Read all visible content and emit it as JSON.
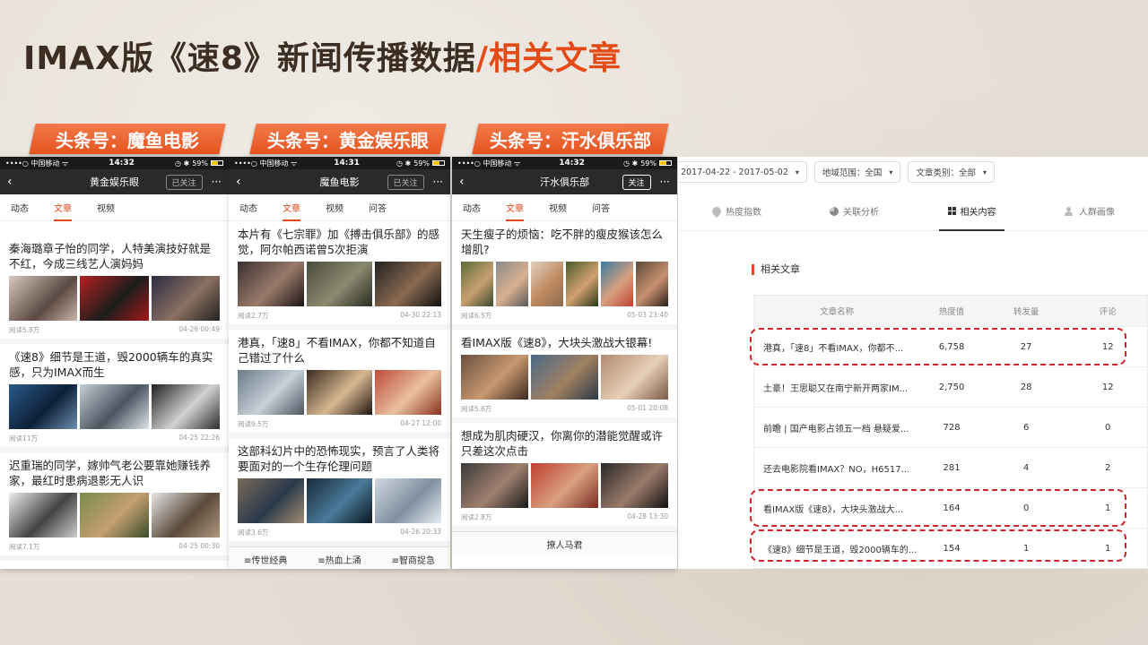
{
  "title": {
    "main": "IMAX版《速8》新闻传播数据",
    "accent": "/相关文章"
  },
  "tags": [
    "头条号：魔鱼电影",
    "头条号：黄金娱乐眼",
    "头条号：汗水俱乐部"
  ],
  "colors": {
    "accent": "#e2481b",
    "title": "#3d2e24",
    "highlight": "#d0262b"
  },
  "phones": [
    {
      "status": {
        "carrier": "••••○ 中国移动 ᯤ",
        "time": "14:32",
        "battery": "59%"
      },
      "nav": {
        "back": "‹",
        "name": "黄金娱乐眼",
        "follow": "已关注",
        "more": "···"
      },
      "tabs": [
        "动态",
        "文章",
        "视频"
      ],
      "articles": [
        {
          "headline": "秦海璐章子怡的同学，人特美演技好就是不红，今成三线艺人演妈妈",
          "reads": "阅读5.8万",
          "date": "04-26 00:49"
        },
        {
          "headline": "《速8》细节是王道，毁2000辆车的真实感，只为IMAX而生",
          "reads": "阅读11万",
          "date": "04-25 22:26"
        },
        {
          "headline": "迟重瑞的同学，嫁帅气老公要靠她赚钱养家，最红时患病退影无人识",
          "reads": "阅读7.1万",
          "date": "04-25 00:30"
        }
      ]
    },
    {
      "status": {
        "carrier": "••••○ 中国移动 ᯤ",
        "time": "14:31",
        "battery": "59%"
      },
      "nav": {
        "back": "‹",
        "name": "魔鱼电影",
        "follow": "已关注",
        "more": "···"
      },
      "tabs": [
        "动态",
        "文章",
        "视频",
        "问答"
      ],
      "articles": [
        {
          "headline": "本片有《七宗罪》加《搏击俱乐部》的感觉，阿尔帕西诺曾5次拒演",
          "reads": "阅读2.7万",
          "date": "04-30 22:13"
        },
        {
          "headline": "港真，「速8」不看IMAX，你都不知道自己错过了什么",
          "reads": "阅读9.5万",
          "date": "04-27 12:00"
        },
        {
          "headline": "这部科幻片中的恐怖现实，预言了人类将要面对的一个生存伦理问题",
          "reads": "阅读3.6万",
          "date": "04-26 20:33"
        }
      ],
      "bottom_nav": [
        "≡传世经典",
        "≡热血上涌",
        "≡智商捉急"
      ]
    },
    {
      "status": {
        "carrier": "••••○ 中国移动 ᯤ",
        "time": "14:32",
        "battery": "59%"
      },
      "nav": {
        "back": "‹",
        "name": "汗水俱乐部",
        "follow": "关注",
        "more": "···"
      },
      "tabs": [
        "动态",
        "文章",
        "视频",
        "问答"
      ],
      "articles": [
        {
          "headline": "天生瘦子的烦恼：吃不胖的瘦皮猴该怎么增肌?",
          "reads": "阅读6.5万",
          "date": "05-03 23:40"
        },
        {
          "headline": "看IMAX版《速8》，大块头激战大银幕!",
          "reads": "阅读5.6万",
          "date": "05-01 20:08"
        },
        {
          "headline": "想成为肌肉硬汉，你离你的潜能觉醒或许只差这次点击",
          "reads": "阅读2.8万",
          "date": "04-28 13:30"
        }
      ],
      "bottom_nav": [
        "撩人马君"
      ]
    }
  ],
  "panel": {
    "filters": [
      {
        "label": "2017-04-22 - 2017-05-02"
      },
      {
        "label": "地域范围：全国"
      },
      {
        "label": "文章类别：全部"
      }
    ],
    "subtabs": [
      "热度指数",
      "关联分析",
      "相关内容",
      "人群画像"
    ],
    "section_title": "相关文章",
    "table": {
      "headers": [
        "文章名称",
        "热度值",
        "转发量",
        "评论"
      ],
      "rows": [
        [
          "港真，「速8」不看IMAX，你都不...",
          "6,758",
          "27",
          "12"
        ],
        [
          "土豪！王思聪又在南宁新开两家IM...",
          "2,750",
          "28",
          "12"
        ],
        [
          "前瞻 | 国产电影占领五一档 悬疑爱...",
          "728",
          "6",
          "0"
        ],
        [
          "还去电影院看IMAX？NO，H6517...",
          "281",
          "4",
          "2"
        ],
        [
          "看IMAX版《速8》，大块头激战大...",
          "164",
          "0",
          "1"
        ],
        [
          "《速8》细节是王道，毁2000辆车的...",
          "154",
          "1",
          "1"
        ]
      ]
    }
  }
}
